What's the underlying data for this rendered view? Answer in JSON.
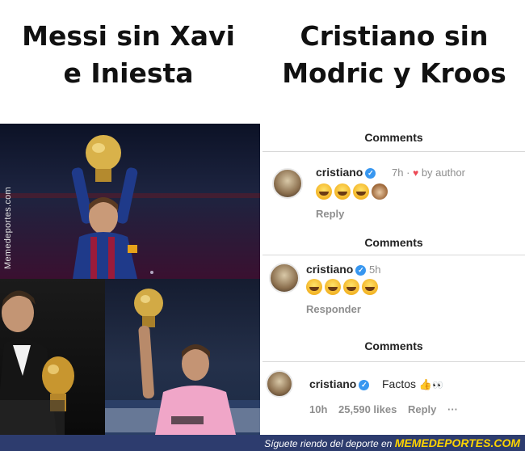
{
  "left_title": {
    "line1": "Messi sin Xavi",
    "line2": "e Iniesta"
  },
  "right_title": {
    "line1": "Cristiano sin",
    "line2": "Modric y Kroos"
  },
  "side_watermark": "Memedeportes.com",
  "comments": [
    {
      "header": "Comments",
      "username": "cristiano",
      "time": "7h",
      "separator": "·",
      "liked_by": "by author",
      "reply": "Reply"
    },
    {
      "header": "Comments",
      "username": "cristiano",
      "time": "5h",
      "reply": "Responder"
    },
    {
      "header": "Comments",
      "username": "cristiano",
      "text": "Factos",
      "time": "10h",
      "likes": "25,590 likes",
      "reply": "Reply",
      "more": "···"
    }
  ],
  "banner": {
    "text": "Síguete riendo del deporte en",
    "brand": "MEMEDEPORTES.COM"
  },
  "colors": {
    "banner_bg": "#2d3c6e",
    "brand": "#ffd400",
    "verified": "#3897f0",
    "heart": "#ed4956"
  }
}
